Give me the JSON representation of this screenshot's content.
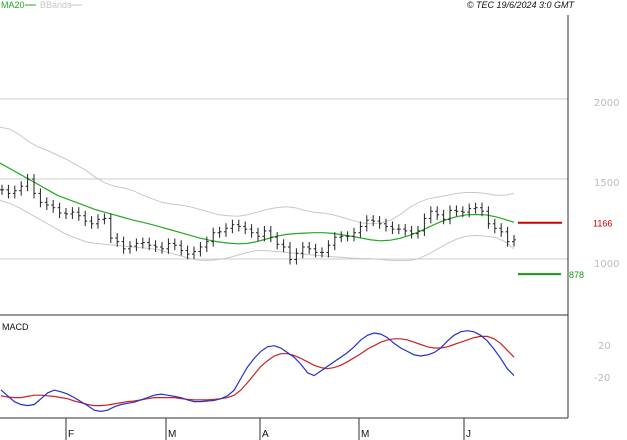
{
  "header": {
    "legend_ma20": "MA20",
    "legend_bbands": "BBands",
    "copyright": "© TEC 19/6/2024 3:0 GMT"
  },
  "colors": {
    "ma20": "#22aa22",
    "bbands": "#c8c8c8",
    "ohlc": "#222222",
    "macd": "#2233cc",
    "signal": "#cc2222",
    "resistance": "#cc0000",
    "support": "#119911",
    "grid": "#cccccc",
    "axis": "#333333"
  },
  "chart_data": [
    {
      "type": "line",
      "title": "",
      "xlabel": "",
      "ylabel": "",
      "x_ticks": [
        "F",
        "M",
        "A",
        "M",
        "J"
      ],
      "y_ticks": [
        "2000",
        "1500",
        "1000"
      ],
      "ylim": [
        700,
        2300
      ],
      "grid": true,
      "legend": "top-left",
      "series": [
        {
          "name": "MA20",
          "values": [
            1500,
            1470,
            1440,
            1410,
            1380,
            1350,
            1320,
            1300,
            1280,
            1260,
            1240,
            1225,
            1210,
            1195,
            1180,
            1168,
            1155,
            1140,
            1125,
            1110,
            1095,
            1080,
            1068,
            1058,
            1052,
            1048,
            1050,
            1060,
            1075,
            1090,
            1100,
            1105,
            1108,
            1110,
            1110,
            1106,
            1098,
            1090,
            1080,
            1070,
            1065,
            1068,
            1078,
            1095,
            1115,
            1140,
            1165,
            1185,
            1200,
            1210,
            1212,
            1210,
            1200,
            1185,
            1168
          ]
        },
        {
          "name": "BBands",
          "values": [
            1700,
            1690,
            1660,
            1620,
            1590,
            1570,
            1545,
            1520,
            1490,
            1460,
            1420,
            1390,
            1370,
            1360,
            1345,
            1320,
            1300,
            1280,
            1270,
            1265,
            1255,
            1240,
            1225,
            1210,
            1205,
            1202,
            1210,
            1225,
            1240,
            1250,
            1255,
            1250,
            1235,
            1225,
            1220,
            1210,
            1195,
            1180,
            1165,
            1160,
            1165,
            1180,
            1210,
            1250,
            1280,
            1300,
            1310,
            1320,
            1330,
            1335,
            1335,
            1330,
            1320,
            1320,
            1330
          ]
        },
        {
          "name": "",
          "values": [
            1290,
            1275,
            1250,
            1220,
            1190,
            1160,
            1130,
            1100,
            1080,
            1060,
            1050,
            1045,
            1040,
            1035,
            1030,
            1025,
            1020,
            1010,
            995,
            980,
            965,
            955,
            955,
            960,
            970,
            985,
            1000,
            1010,
            1010,
            1005,
            1000,
            995,
            990,
            985,
            980,
            975,
            972,
            968,
            965,
            965,
            960,
            955,
            955,
            955,
            965,
            990,
            1020,
            1050,
            1075,
            1090,
            1095,
            1090,
            1085,
            1060,
            1020
          ]
        }
      ],
      "price_bars": {
        "values": [
          1350,
          1330,
          1345,
          1370,
          1410,
          1330,
          1280,
          1265,
          1250,
          1220,
          1215,
          1225,
          1205,
          1175,
          1160,
          1185,
          1190,
          1080,
          1060,
          1020,
          1035,
          1050,
          1055,
          1040,
          1030,
          1020,
          1050,
          1040,
          1010,
          990,
          1005,
          1030,
          1060,
          1110,
          1115,
          1135,
          1155,
          1145,
          1130,
          1110,
          1090,
          1120,
          1085,
          1045,
          1030,
          960,
          995,
          1030,
          1020,
          1000,
          1000,
          1040,
          1085,
          1090,
          1090,
          1110,
          1145,
          1180,
          1175,
          1160,
          1145,
          1130,
          1130,
          1120,
          1105,
          1120,
          1190,
          1230,
          1210,
          1185,
          1235,
          1230,
          1225,
          1245,
          1250,
          1230,
          1160,
          1135,
          1115,
          1060,
          1070
        ]
      },
      "levels": [
        {
          "label": "1166",
          "value": 1166
        },
        {
          "label": "878",
          "value": 878
        }
      ]
    },
    {
      "type": "line",
      "title": "MACD",
      "xlabel": "",
      "ylabel": "",
      "y_ticks": [
        "20",
        "-20"
      ],
      "ylim": [
        -80,
        90
      ],
      "grid": false,
      "series": [
        {
          "name": "",
          "values": [
            -35,
            -45,
            -55,
            -60,
            -62,
            -60,
            -50,
            -40,
            -35,
            -38,
            -42,
            -48,
            -55,
            -62,
            -70,
            -72,
            -70,
            -64,
            -60,
            -58,
            -56,
            -52,
            -48,
            -44,
            -42,
            -44,
            -46,
            -48,
            -52,
            -55,
            -55,
            -54,
            -53,
            -50,
            -45,
            -35,
            -15,
            5,
            20,
            32,
            40,
            42,
            38,
            30,
            22,
            10,
            -5,
            -10,
            -2,
            6,
            14,
            22,
            30,
            40,
            52,
            60,
            64,
            62,
            56,
            46,
            38,
            32,
            26,
            24,
            26,
            30,
            38,
            50,
            60,
            66,
            68,
            66,
            60,
            50,
            36,
            20,
            2,
            -10
          ]
        },
        {
          "name": "",
          "values": [
            -45,
            -47,
            -48,
            -48,
            -46,
            -44,
            -44,
            -45,
            -46,
            -48,
            -50,
            -54,
            -57,
            -60,
            -62,
            -62,
            -61,
            -59,
            -57,
            -55,
            -54,
            -52,
            -50,
            -48,
            -48,
            -48,
            -48,
            -50,
            -51,
            -52,
            -52,
            -52,
            -51,
            -50,
            -48,
            -44,
            -35,
            -22,
            -8,
            6,
            16,
            24,
            28,
            28,
            25,
            20,
            14,
            8,
            4,
            2,
            4,
            8,
            14,
            21,
            28,
            36,
            42,
            48,
            52,
            54,
            54,
            52,
            48,
            44,
            40,
            38,
            38,
            40,
            44,
            48,
            52,
            56,
            58,
            58,
            54,
            46,
            34,
            22
          ]
        }
      ]
    }
  ]
}
